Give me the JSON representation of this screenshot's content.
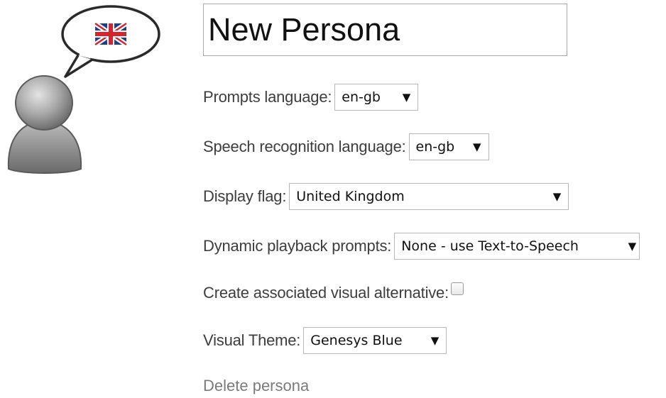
{
  "persona": {
    "name": "New Persona"
  },
  "form": {
    "prompts_language": {
      "label": "Prompts language:",
      "value": "en-gb"
    },
    "speech_language": {
      "label": "Speech recognition language:",
      "value": "en-gb"
    },
    "display_flag": {
      "label": "Display flag:",
      "value": "United Kingdom"
    },
    "dynamic_prompts": {
      "label": "Dynamic playback prompts:",
      "value": "None - use Text-to-Speech"
    },
    "visual_alternative": {
      "label": "Create associated visual alternative:",
      "checked": false
    },
    "visual_theme": {
      "label": "Visual Theme:",
      "value": "Genesys Blue"
    }
  },
  "actions": {
    "delete_label": "Delete persona"
  },
  "icons": {
    "avatar": "user-avatar-icon",
    "flag": "uk-flag-icon",
    "caret": "dropdown-caret-icon"
  }
}
